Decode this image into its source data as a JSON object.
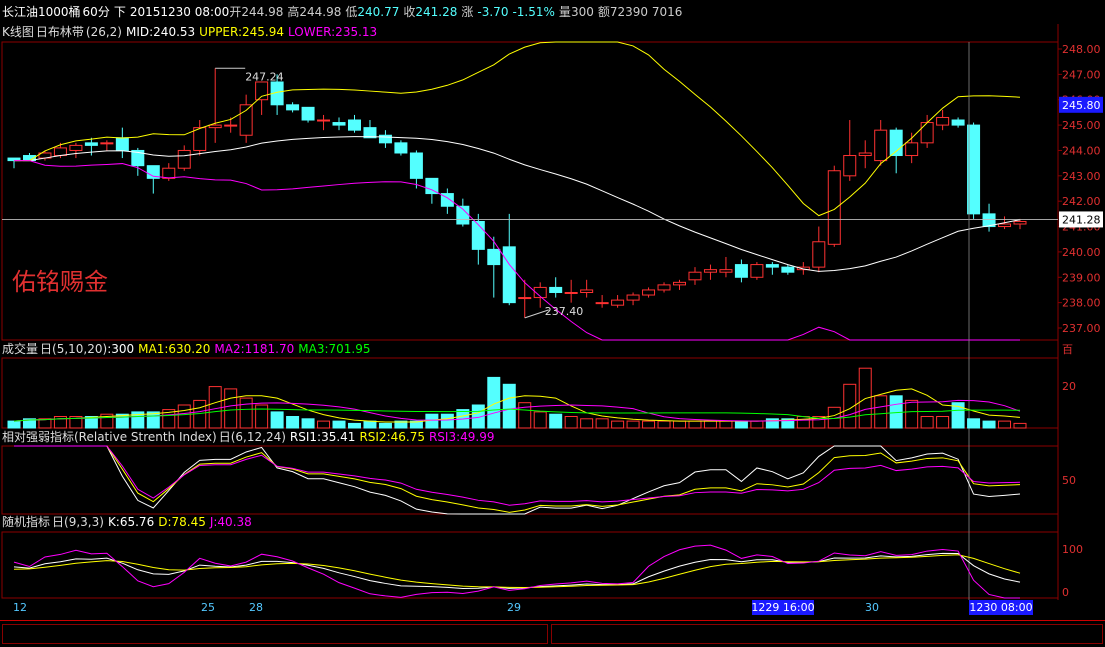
{
  "header": {
    "symbol": "长江油1000桶",
    "period": "60分",
    "direction": "下",
    "datetime": "20151230 08:00",
    "open_label": "开",
    "open": "244.98",
    "high_label": "高",
    "high": "244.98",
    "low_label": "低",
    "low": "240.77",
    "close_label": "收",
    "close": "241.28",
    "change_label": "涨",
    "change": "-3.70",
    "change_pct": "-1.51%",
    "volume_label": "量",
    "volume": "300",
    "amount_label": "额",
    "amount": "72390 7016"
  },
  "colors": {
    "up": "#ff3232",
    "down": "#54ffff",
    "mid": "#ffffff",
    "upper": "#ffff00",
    "lower": "#ff00ff",
    "grid": "#8b0000",
    "ma3": "#00ff00"
  },
  "panels": {
    "kline": {
      "name": "K线图",
      "icon": "日",
      "indicator": "布林带",
      "params": "(26,2)",
      "mid_label": "MID:240.53",
      "upper_label": "UPPER:245.94",
      "lower_label": "LOWER:235.13"
    },
    "volume": {
      "name": "成交量",
      "icon": "日",
      "params": "(5,10,20)",
      "vol_label": ":300",
      "ma1_label": "MA1:630.20",
      "ma2_label": "MA2:1181.70",
      "ma3_label": "MA3:701.95",
      "unit": "百"
    },
    "rsi": {
      "name": "相对强弱指标(Relative Strenth Index)",
      "icon": "日",
      "params": "(6,12,24)",
      "rsi1_label": "RSI1:35.41",
      "rsi2_label": "RSI2:46.75",
      "rsi3_label": "RSI3:49.99"
    },
    "kdj": {
      "name": "随机指标",
      "icon": "日",
      "params": "(9,3,3)",
      "k_label": "K:65.76",
      "d_label": "D:78.45",
      "j_label": "J:40.38"
    }
  },
  "watermark": "佑铭赐金",
  "annotations": {
    "high_mark": "247.24",
    "low_mark": "237.40",
    "current_price": "241.28",
    "last_price": "245.80"
  },
  "x_labels": [
    "12",
    "25",
    "28",
    "29",
    "30"
  ],
  "x_highlights": [
    "1229 16:00",
    "1230 08:00"
  ],
  "chart_data": {
    "type": "candlestick",
    "price_axis": {
      "min": 237,
      "max": 248,
      "ticks": [
        "248.00",
        "247.00",
        "246.00",
        "245.00",
        "244.00",
        "243.00",
        "242.00",
        "241.00",
        "240.00",
        "239.00",
        "238.00",
        "237.00"
      ]
    },
    "volume_axis": {
      "ticks": [
        "20"
      ]
    },
    "rsi_axis": {
      "ticks": [
        "50"
      ]
    },
    "kdj_axis": {
      "ticks": [
        "100",
        "50",
        "0"
      ]
    },
    "candles": [
      [
        243.7,
        243.6,
        243.7,
        243.3
      ],
      [
        243.8,
        243.6,
        243.9,
        243.6
      ],
      [
        243.7,
        243.9,
        244.0,
        243.6
      ],
      [
        243.8,
        244.1,
        244.3,
        243.7
      ],
      [
        244.0,
        244.2,
        244.3,
        243.7
      ],
      [
        244.3,
        244.2,
        244.5,
        243.8
      ],
      [
        244.3,
        244.3,
        244.4,
        244.0
      ],
      [
        244.5,
        244.0,
        244.9,
        243.7
      ],
      [
        244.0,
        243.4,
        244.1,
        243.0
      ],
      [
        243.4,
        242.9,
        243.4,
        242.3
      ],
      [
        242.9,
        243.3,
        243.5,
        242.8
      ],
      [
        243.3,
        244.0,
        244.2,
        243.2
      ],
      [
        244.0,
        244.9,
        245.2,
        243.8
      ],
      [
        244.9,
        245.0,
        247.24,
        244.3
      ],
      [
        245.0,
        245.0,
        245.3,
        244.7
      ],
      [
        244.6,
        245.8,
        246.2,
        244.3
      ],
      [
        246.0,
        246.7,
        246.7,
        245.4
      ],
      [
        246.7,
        245.8,
        247.0,
        245.4
      ],
      [
        245.8,
        245.6,
        245.9,
        245.5
      ],
      [
        245.7,
        245.2,
        245.7,
        245.1
      ],
      [
        245.2,
        245.2,
        245.4,
        244.8
      ],
      [
        245.1,
        245.0,
        245.3,
        244.8
      ],
      [
        245.2,
        244.8,
        245.4,
        244.7
      ],
      [
        244.9,
        244.5,
        245.2,
        244.5
      ],
      [
        244.6,
        244.3,
        244.8,
        244.1
      ],
      [
        244.3,
        243.9,
        244.4,
        243.8
      ],
      [
        243.9,
        242.9,
        244.0,
        242.5
      ],
      [
        242.9,
        242.3,
        242.9,
        241.9
      ],
      [
        242.3,
        241.8,
        242.5,
        241.5
      ],
      [
        241.8,
        241.1,
        242.1,
        241.0
      ],
      [
        241.2,
        240.1,
        241.5,
        239.5
      ],
      [
        240.1,
        239.5,
        240.6,
        238.2
      ],
      [
        240.2,
        238.0,
        241.5,
        237.9
      ],
      [
        238.2,
        238.2,
        238.9,
        237.4
      ],
      [
        238.2,
        238.6,
        238.8,
        237.8
      ],
      [
        238.6,
        238.4,
        239.0,
        238.2
      ],
      [
        238.4,
        238.4,
        238.9,
        238.0
      ],
      [
        238.4,
        238.5,
        238.9,
        238.2
      ],
      [
        238.0,
        238.0,
        238.3,
        237.8
      ],
      [
        237.9,
        238.1,
        238.3,
        237.8
      ],
      [
        238.1,
        238.3,
        238.4,
        237.9
      ],
      [
        238.3,
        238.5,
        238.6,
        238.2
      ],
      [
        238.5,
        238.7,
        238.8,
        238.4
      ],
      [
        238.7,
        238.8,
        238.9,
        238.5
      ],
      [
        238.9,
        239.2,
        239.4,
        238.7
      ],
      [
        239.2,
        239.3,
        239.5,
        238.9
      ],
      [
        239.2,
        239.3,
        239.8,
        239.0
      ],
      [
        239.5,
        239.0,
        239.7,
        238.8
      ],
      [
        239.0,
        239.5,
        239.6,
        238.9
      ],
      [
        239.5,
        239.4,
        239.6,
        239.1
      ],
      [
        239.4,
        239.2,
        239.5,
        239.1
      ],
      [
        239.3,
        239.4,
        239.6,
        239.1
      ],
      [
        239.4,
        240.4,
        241.0,
        239.2
      ],
      [
        240.3,
        243.2,
        243.4,
        240.2
      ],
      [
        243.0,
        243.8,
        245.2,
        242.8
      ],
      [
        243.8,
        243.9,
        244.4,
        243.3
      ],
      [
        243.6,
        244.8,
        245.2,
        243.4
      ],
      [
        244.8,
        243.8,
        244.9,
        243.1
      ],
      [
        243.8,
        244.3,
        244.7,
        243.5
      ],
      [
        244.3,
        245.1,
        245.4,
        244.1
      ],
      [
        245.0,
        245.3,
        245.6,
        244.8
      ],
      [
        245.2,
        245.0,
        245.3,
        244.9
      ],
      [
        245.0,
        241.5,
        245.1,
        241.3
      ],
      [
        241.5,
        241.0,
        241.9,
        240.8
      ],
      [
        241.0,
        241.1,
        241.4,
        240.9
      ],
      [
        241.1,
        241.2,
        241.3,
        240.9
      ]
    ],
    "volume_values": [
      3,
      4,
      4,
      5,
      5,
      5,
      6,
      6,
      7,
      7,
      8,
      10,
      12,
      18,
      17,
      13,
      10,
      7,
      5,
      4,
      3,
      3,
      2,
      3,
      2,
      3,
      3,
      6,
      6,
      8,
      10,
      22,
      19,
      11,
      7,
      6,
      5,
      4,
      4,
      3,
      3,
      3,
      3,
      3,
      3,
      3,
      3,
      3,
      3,
      4,
      4,
      5,
      5,
      9,
      19,
      26,
      14,
      14,
      12,
      5,
      5,
      11,
      4,
      3,
      3,
      2
    ]
  }
}
